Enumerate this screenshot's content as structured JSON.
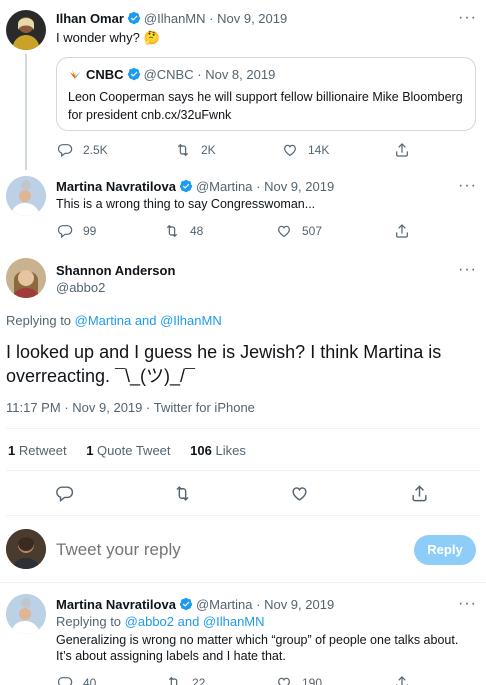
{
  "tweet1": {
    "name": "Ilhan Omar",
    "handle": "@IlhanMN",
    "sep": "·",
    "date": "Nov 9, 2019",
    "text": "I wonder why?",
    "emoji": "🤔",
    "quote": {
      "name": "CNBC",
      "handle": "@CNBC",
      "sep": "·",
      "date": "Nov 8, 2019",
      "text_line1": "Leon Cooperman says he will support fellow billionaire Mike Bloomberg",
      "text_line2": "for president cnb.cx/32uFwnk"
    },
    "replies": "2.5K",
    "retweets": "2K",
    "likes": "14K"
  },
  "tweet2": {
    "name": "Martina Navratilova",
    "handle": "@Martina",
    "sep": "·",
    "date": "Nov 9, 2019",
    "text": "This is a wrong thing to say Congresswoman...",
    "replies": "99",
    "retweets": "48",
    "likes": "507"
  },
  "main": {
    "name": "Shannon Anderson",
    "handle": "@abbo2",
    "replying_prefix": "Replying to ",
    "replying_to": "@Martina and @IlhanMN",
    "text_line1": "I looked up and I guess he is Jewish? I think Martina is",
    "text_line2": "overreacting. ¯\\_(ツ)_/¯",
    "time": "11:17 PM",
    "sep": "·",
    "date": "Nov 9, 2019",
    "source": "Twitter for iPhone",
    "retweets_count": "1",
    "retweets_label": "Retweet",
    "quotes_count": "1",
    "quotes_label": "Quote Tweet",
    "likes_count": "106",
    "likes_label": "Likes"
  },
  "compose": {
    "placeholder": "Tweet your reply",
    "button": "Reply"
  },
  "tweet3": {
    "name": "Martina Navratilova",
    "handle": "@Martina",
    "sep": "·",
    "date": "Nov 9, 2019",
    "replying_prefix": "Replying to ",
    "replying_to": "@abbo2 and @IlhanMN",
    "text_line1": "Generalizing is wrong no matter which “group” of people one talks about.",
    "text_line2": "It’s about assigning labels and I hate that.",
    "replies": "40",
    "retweets": "22",
    "likes": "190"
  },
  "colors": {
    "accent": "#1d9bf0",
    "muted": "#536471",
    "reply_button_disabled": "#8ecdf8"
  },
  "icons": [
    "more-icon",
    "verified-icon",
    "reply-icon",
    "retweet-icon",
    "like-icon",
    "share-icon",
    "cnbc-logo-icon"
  ]
}
